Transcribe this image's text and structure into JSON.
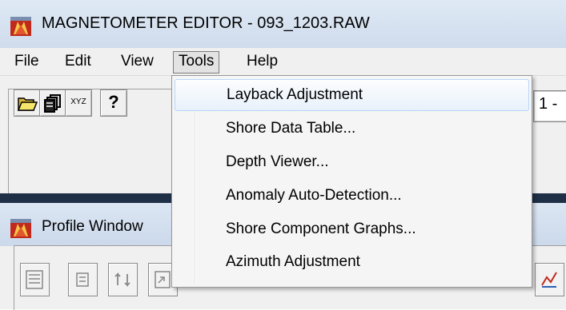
{
  "window": {
    "title": "MAGNETOMETER EDITOR - 093_1203.RAW",
    "icon": "magnetometer-app-icon"
  },
  "menubar": {
    "items": [
      {
        "label": "File"
      },
      {
        "label": "Edit"
      },
      {
        "label": "View"
      },
      {
        "label": "Tools",
        "active": true
      },
      {
        "label": "Help"
      }
    ]
  },
  "toolbar": {
    "buttons": [
      {
        "icon": "folder-open-icon"
      },
      {
        "icon": "copy-pages-icon"
      },
      {
        "icon": "xyz-icon",
        "label": "XYZ"
      },
      {
        "icon": "help-icon",
        "label": "?"
      }
    ],
    "pager_text": "1 -"
  },
  "tools_menu": {
    "items": [
      {
        "label": "Layback Adjustment",
        "highlighted": true
      },
      {
        "label": "Shore Data Table..."
      },
      {
        "label": "Depth Viewer..."
      },
      {
        "label": "Anomaly Auto-Detection..."
      },
      {
        "label": "Shore Component Graphs..."
      },
      {
        "label": "Azimuth Adjustment"
      }
    ]
  },
  "profile_window": {
    "title": "Profile Window",
    "icon": "magnetometer-app-icon"
  },
  "colors": {
    "titlebar": "#dfe9f5",
    "menu_hover_border": "#b8d6fb",
    "separator": "#1e2f46",
    "app_icon_red": "#c0291c"
  }
}
